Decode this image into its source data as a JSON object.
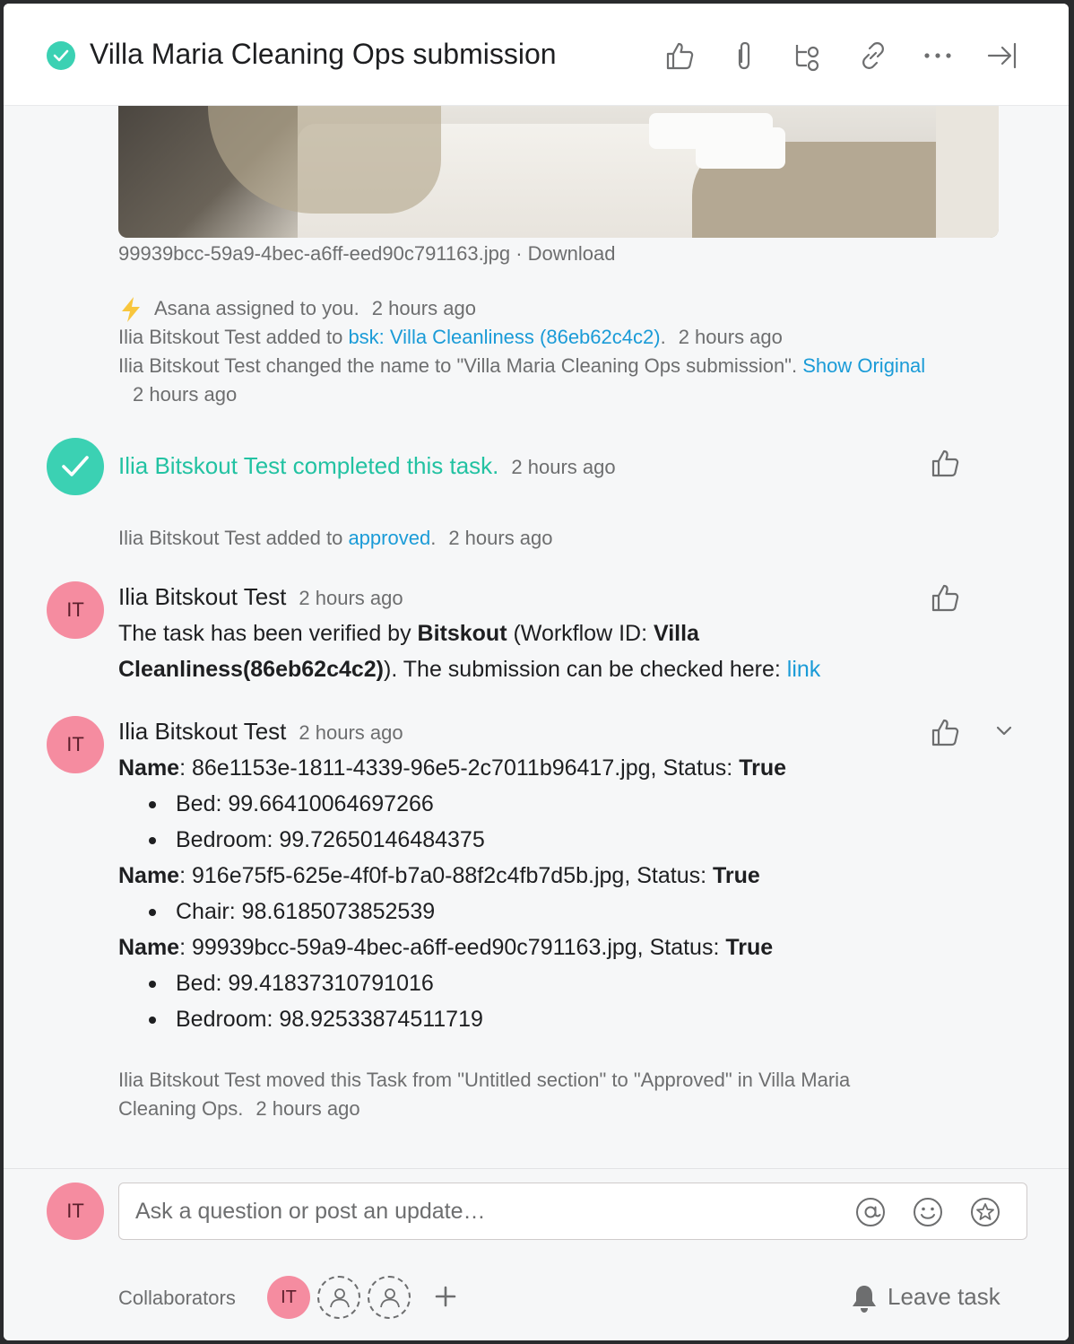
{
  "header": {
    "title": "Villa Maria Cleaning Ops submission",
    "icons": [
      "like-icon",
      "attach-icon",
      "subtask-icon",
      "link-icon",
      "more-icon",
      "close-pane-icon"
    ]
  },
  "attachment": {
    "filename": "99939bcc-59a9-4bec-a6ff-eed90c791163.jpg",
    "separator": " · ",
    "download_label": "Download"
  },
  "stories": {
    "assigned": {
      "actor": "Asana",
      "text": " assigned to you.",
      "time": "2 hours ago"
    },
    "added_project": {
      "actor": "Ilia Bitskout Test",
      "text": " added to ",
      "link": "bsk: Villa Cleanliness (86eb62c4c2)",
      "after": ".",
      "time": "2 hours ago"
    },
    "renamed": {
      "actor": "Ilia Bitskout Test",
      "text": " changed the name to \"Villa Maria Cleaning Ops submission\". ",
      "link": "Show Original",
      "time": "2 hours ago"
    },
    "completed": {
      "text": "Ilia Bitskout Test completed this task.",
      "time": "2 hours ago"
    },
    "added_section": {
      "actor": "Ilia Bitskout Test",
      "text": " added to ",
      "link": "approved",
      "after": ".",
      "time": "2 hours ago"
    },
    "moved": {
      "actor": "Ilia Bitskout Test",
      "text_line1": " moved this Task from \"Untitled section\" to \"Approved\" in Villa Maria",
      "text_line2": "Cleaning Ops.",
      "time": "2 hours ago"
    }
  },
  "comments": [
    {
      "initials": "IT",
      "author": "Ilia Bitskout Test",
      "time": "2 hours ago",
      "p1": "The task has been verified by ",
      "b1": "Bitskout",
      "p2": " (Workflow ID: ",
      "b2": "Villa Cleanliness(86eb62c4c2)",
      "p3": "). The submission can be checked here: ",
      "link": "link"
    },
    {
      "initials": "IT",
      "author": "Ilia Bitskout Test",
      "time": "2 hours ago",
      "name_label": "Name",
      "status_label": "Status:",
      "results": [
        {
          "file": ": 86e1153e-1811-4339-96e5-2c7011b96417.jpg, ",
          "status": "True",
          "items": [
            "Bed: 99.66410064697266",
            "Bedroom: 99.72650146484375"
          ]
        },
        {
          "file": ": 916e75f5-625e-4f0f-b7a0-88f2c4fb7d5b.jpg, ",
          "status": "True",
          "items": [
            "Chair: 98.6185073852539"
          ]
        },
        {
          "file": ": 99939bcc-59a9-4bec-a6ff-eed90c791163.jpg, ",
          "status": "True",
          "items": [
            "Bed: 99.41837310791016",
            "Bedroom: 98.92533874511719"
          ]
        }
      ]
    }
  ],
  "composer": {
    "initials": "IT",
    "placeholder": "Ask a question or post an update…",
    "icons": [
      "mention-icon",
      "emoji-icon",
      "star-icon"
    ]
  },
  "collaborators": {
    "label": "Collaborators",
    "initials": "IT",
    "leave_label": "Leave task"
  },
  "colors": {
    "complete_green": "#3bd1b3",
    "completed_text": "#22c2a2",
    "link_blue": "#1a9bd7",
    "avatar_pink": "#f58ca0",
    "muted_text": "#6d6e6f",
    "bolt": "#f8c63d"
  }
}
